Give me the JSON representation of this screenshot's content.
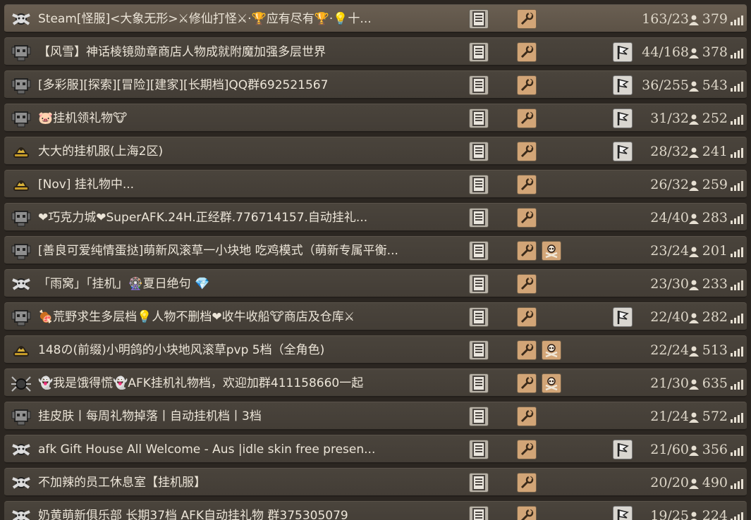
{
  "colors": {
    "row_bg": "#4a443c",
    "page_bg": "#2b2621",
    "text": "#ece5d8",
    "slot_mods": "#d2a577",
    "slot_mode": "#b9b3a8"
  },
  "rows": [
    {
      "char": "beefalo-head-icon",
      "name": "Steam[怪服]<大象无形>⚔修仙打怪⚔·🏆应有尽有🏆·💡十...",
      "mods": true,
      "pvp": false,
      "flag": false,
      "days": "163/23",
      "players": "379",
      "selected": true
    },
    {
      "char": "robot-head-icon",
      "name": "【风雪】神话棱镜勋章商店人物成就附魔加强多层世界",
      "mods": true,
      "pvp": false,
      "flag": true,
      "days": "44/168",
      "players": "378"
    },
    {
      "char": "robot-head-icon",
      "name": "[多彩服][探索][冒险][建家][长期档]QQ群692521567",
      "mods": true,
      "pvp": false,
      "flag": true,
      "days": "36/255",
      "players": "543"
    },
    {
      "char": "robot-head-icon",
      "name": "🐷挂机领礼物🐮",
      "mods": true,
      "pvp": false,
      "flag": true,
      "days": "31/32",
      "players": "252"
    },
    {
      "char": "yellow-hat-icon",
      "name": "大大的挂机服(上海2区)",
      "mods": true,
      "pvp": false,
      "flag": true,
      "days": "28/32",
      "players": "241"
    },
    {
      "char": "yellow-hat-icon",
      "name": "[Nov] 挂礼物中...",
      "mods": true,
      "pvp": false,
      "flag": false,
      "days": "26/32",
      "players": "259"
    },
    {
      "char": "robot-head-icon",
      "name": "❤巧克力城❤SuperAFK.24H.正经群.776714157.自动挂礼...",
      "mods": true,
      "pvp": false,
      "flag": false,
      "days": "24/40",
      "players": "283"
    },
    {
      "char": "robot-head-icon",
      "name": "[善良可爱纯情蛋挞]萌新风滚草一小块地 吃鸡模式（萌新专属平衡...",
      "mods": true,
      "pvp": true,
      "flag": false,
      "days": "23/24",
      "players": "201"
    },
    {
      "char": "beefalo-head-icon",
      "name": "「雨窝」「挂机」🎡夏日绝句 💎",
      "mods": true,
      "pvp": false,
      "flag": false,
      "days": "23/30",
      "players": "233"
    },
    {
      "char": "robot-head-icon",
      "name": "🍖荒野求生多层档💡人物不删档❤收牛收船🐮商店及仓库⚔",
      "mods": true,
      "pvp": false,
      "flag": true,
      "days": "22/40",
      "players": "282"
    },
    {
      "char": "yellow-hat-icon",
      "name": "148の(前缀)小明鸽的小块地风滚草pvp 5档（全角色)",
      "mods": true,
      "pvp": true,
      "flag": false,
      "days": "22/24",
      "players": "513"
    },
    {
      "char": "spider-icon",
      "name": "👻我是饿得慌👻AFK挂机礼物档，欢迎加群411158660一起",
      "mods": true,
      "pvp": true,
      "flag": false,
      "days": "21/30",
      "players": "635"
    },
    {
      "char": "robot-head-icon",
      "name": "挂皮肤丨每周礼物掉落丨自动挂机档丨3档",
      "mods": true,
      "pvp": false,
      "flag": false,
      "days": "21/24",
      "players": "572"
    },
    {
      "char": "beefalo-head-icon",
      "name": "afk Gift House All Welcome - Aus |idle skin free presen...",
      "mods": true,
      "pvp": false,
      "flag": true,
      "days": "21/60",
      "players": "356"
    },
    {
      "char": "beefalo-head-icon",
      "name": "不加辣的员工休息室【挂机服】",
      "mods": true,
      "pvp": false,
      "flag": false,
      "days": "20/20",
      "players": "490"
    },
    {
      "char": "beefalo-head-icon",
      "name": "奶黄萌新俱乐部 长期37档 AFK自动挂礼物 群375305079",
      "mods": true,
      "pvp": false,
      "flag": true,
      "days": "19/25",
      "players": "224"
    }
  ]
}
